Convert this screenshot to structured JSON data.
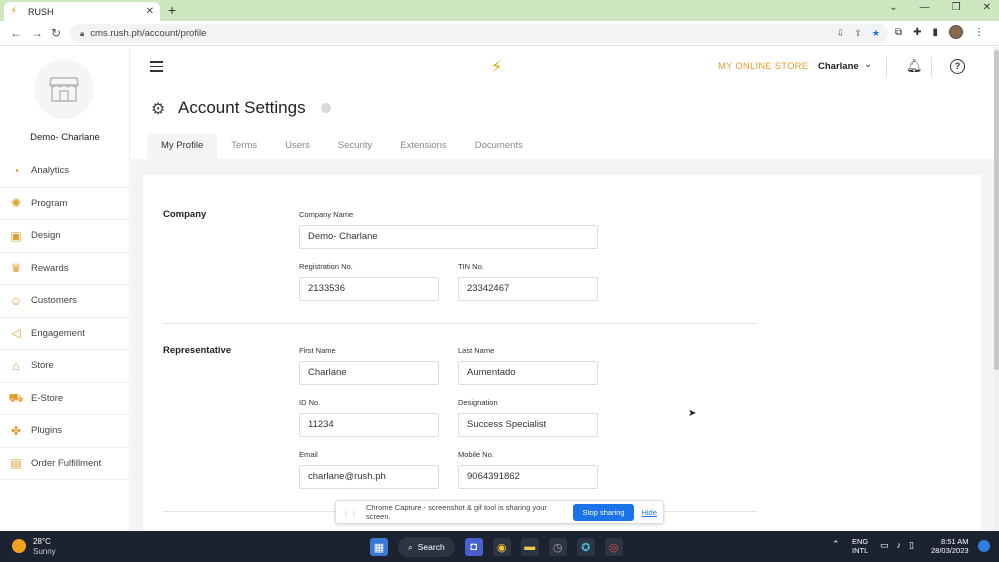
{
  "browser": {
    "tab_title": "RUSH",
    "url": "cms.rush.ph/account/profile"
  },
  "sidebar": {
    "store_name": "Demo- Charlane",
    "items": [
      {
        "label": "Analytics",
        "icon": "analytics-icon"
      },
      {
        "label": "Program",
        "icon": "lightbulb-icon"
      },
      {
        "label": "Design",
        "icon": "design-icon"
      },
      {
        "label": "Rewards",
        "icon": "trophy-icon"
      },
      {
        "label": "Customers",
        "icon": "user-icon"
      },
      {
        "label": "Engagement",
        "icon": "megaphone-icon"
      },
      {
        "label": "Store",
        "icon": "store-icon"
      },
      {
        "label": "E-Store",
        "icon": "cart-icon"
      },
      {
        "label": "Plugins",
        "icon": "puzzle-icon"
      },
      {
        "label": "Order Fulfillment",
        "icon": "box-icon"
      }
    ]
  },
  "header": {
    "store_link": "MY ONLINE STORE",
    "user_name": "Charlane"
  },
  "page": {
    "title": "Account Settings",
    "tabs": [
      "My Profile",
      "Terms",
      "Users",
      "Security",
      "Extensions",
      "Documents"
    ],
    "active_tab": "My Profile"
  },
  "company": {
    "section_label": "Company",
    "company_name_label": "Company Name",
    "company_name": "Demo- Charlane",
    "registration_label": "Registration No.",
    "registration": "2133536",
    "tin_label": "TIN No.",
    "tin": "23342467"
  },
  "representative": {
    "section_label": "Representative",
    "first_name_label": "First Name",
    "first_name": "Charlane",
    "last_name_label": "Last Name",
    "last_name": "Aumentado",
    "id_label": "ID No.",
    "id": "11234",
    "designation_label": "Designation",
    "designation": "Success Specialist",
    "email_label": "Email",
    "email": "charlane@rush.ph",
    "mobile_label": "Mobile No.",
    "mobile": "9064391862"
  },
  "share_bar": {
    "message": "Chrome Capture - screenshot & gif tool is sharing your screen.",
    "stop_label": "Stop sharing",
    "hide_label": "Hide"
  },
  "taskbar": {
    "temperature": "28°C",
    "condition": "Sunny",
    "search_label": "Search",
    "lang_top": "ENG",
    "lang_bottom": "INTL",
    "time": "8:51 AM",
    "date": "28/03/2023"
  },
  "colors": {
    "accent": "#e0a030",
    "tab_bar": "#cde8c0",
    "primary_button": "#1a73e8",
    "taskbar": "#1c2230"
  }
}
